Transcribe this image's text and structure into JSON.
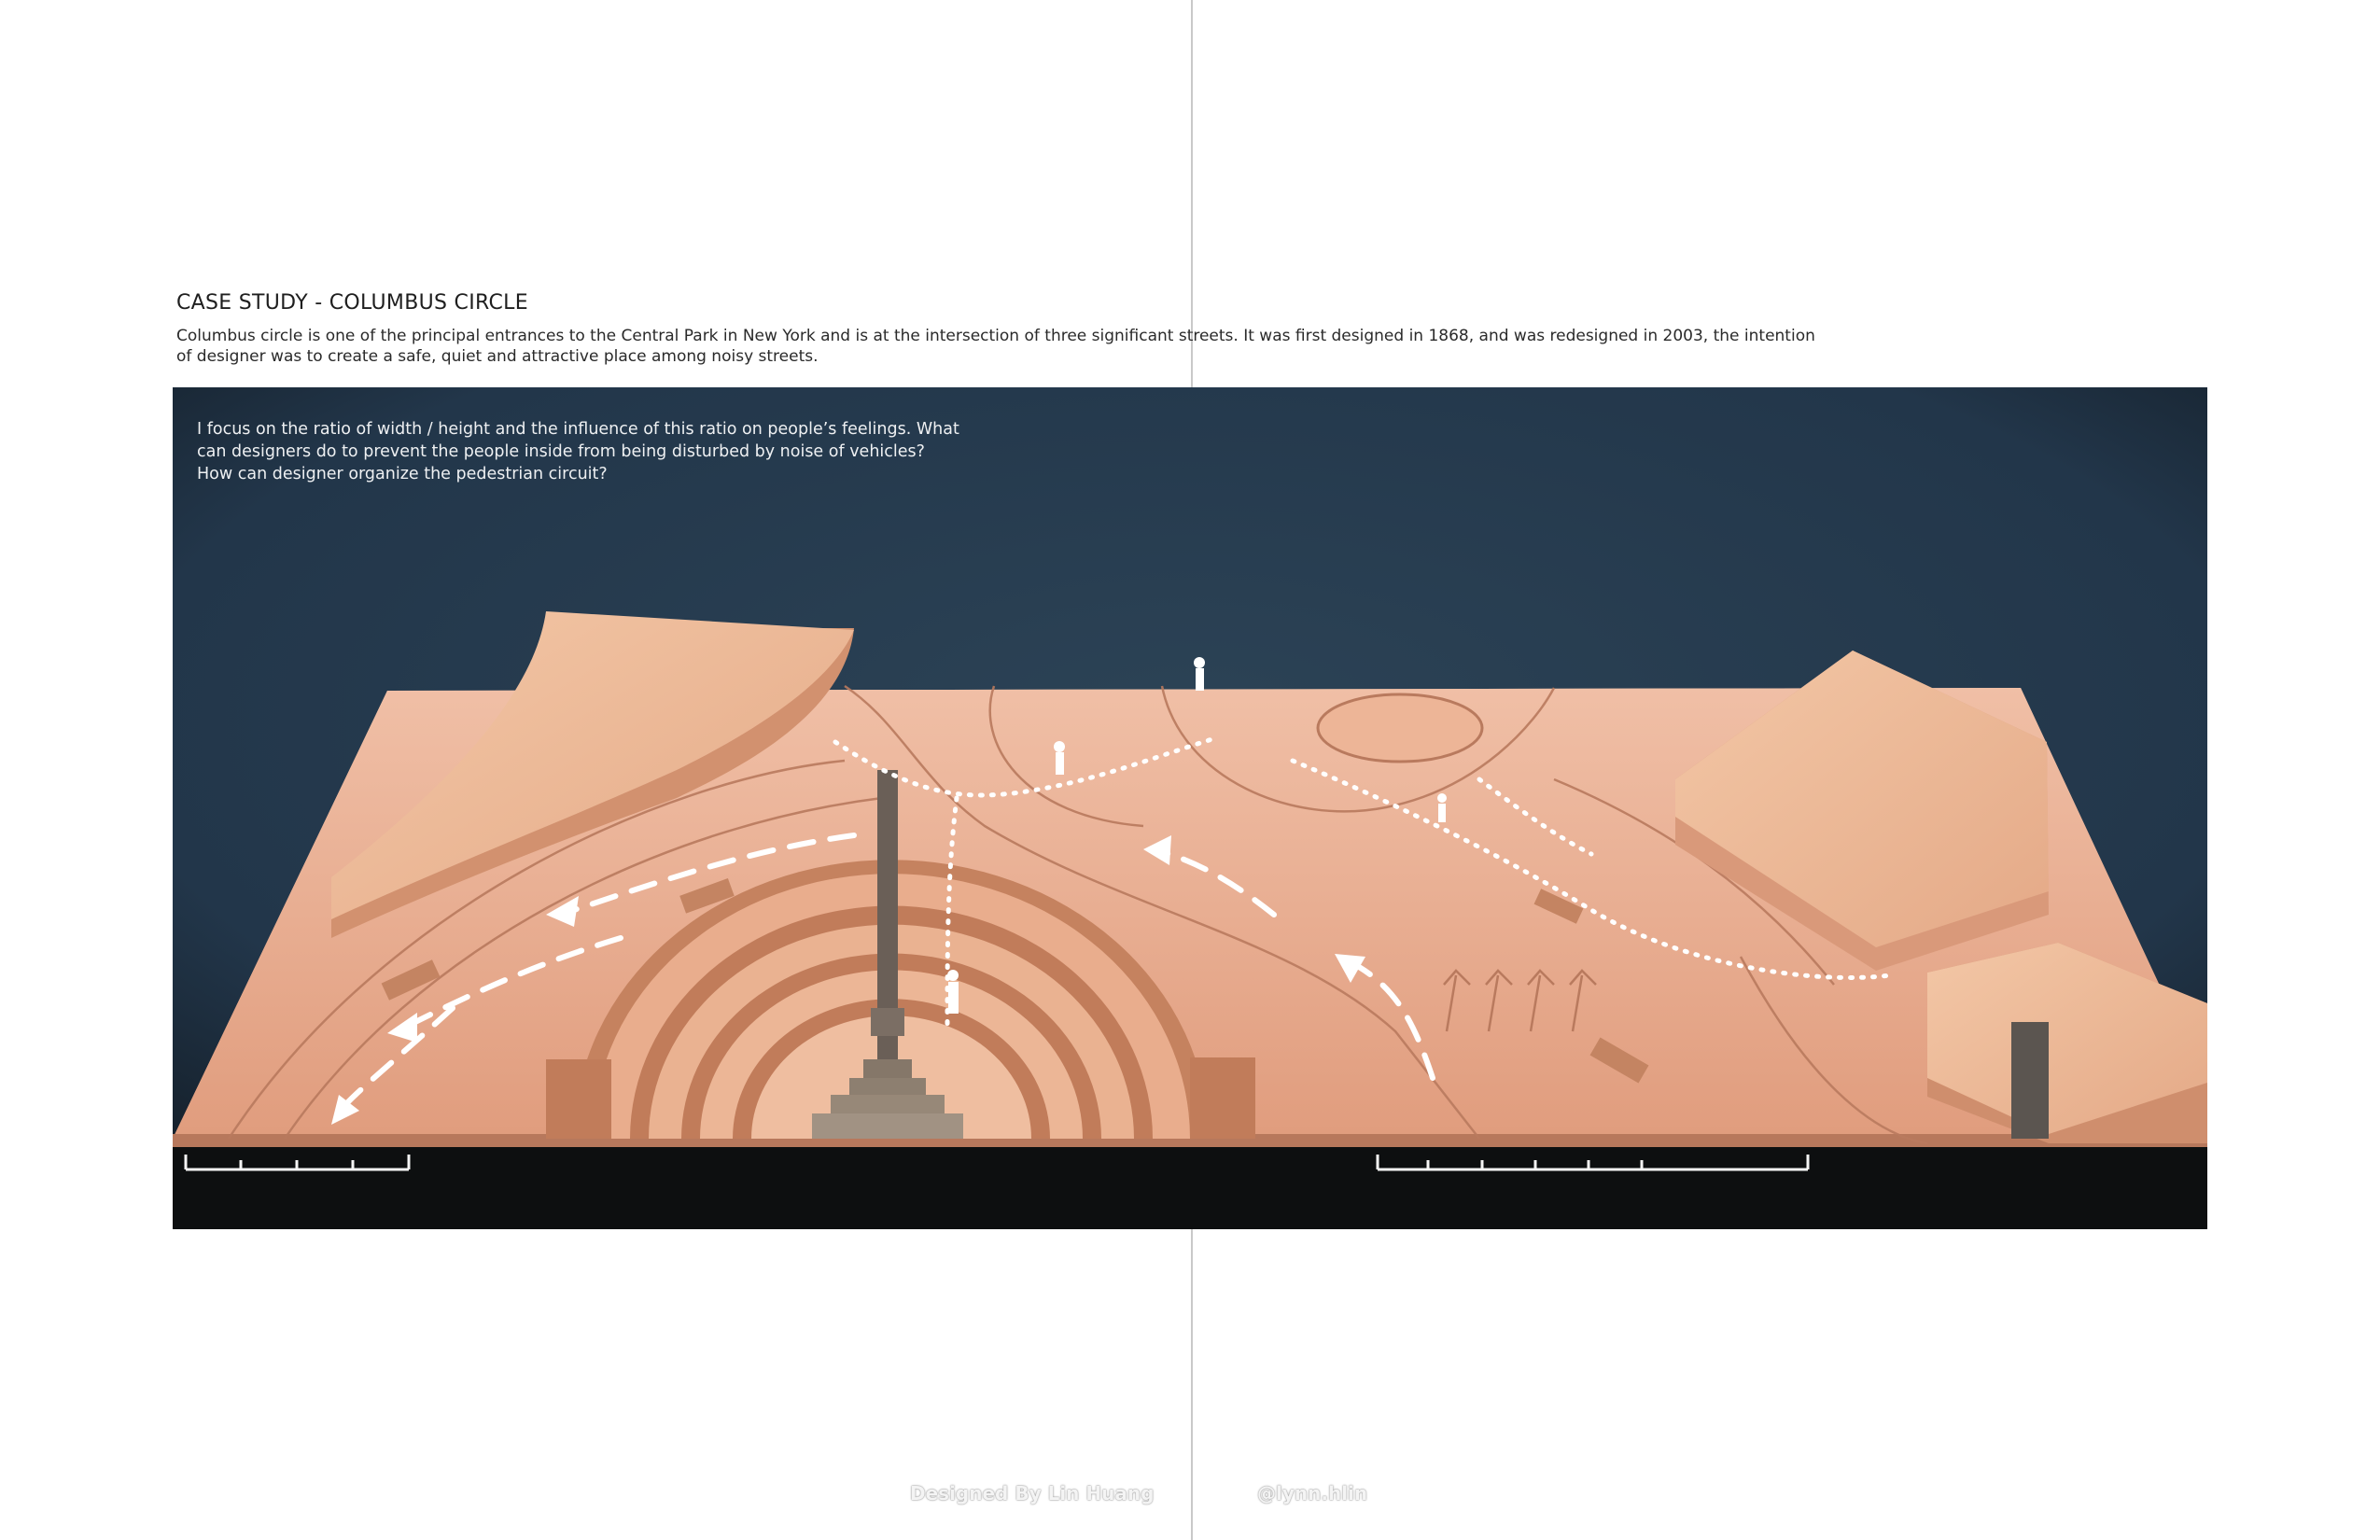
{
  "title": "CASE STUDY - COLUMBUS CIRCLE",
  "intro": "Columbus circle is one of the principal entrances to the Central Park in New York and is at the intersection of three significant streets. It was first designed in 1868, and was redesigned in 2003, the intention of designer was to create a safe, quiet and attractive place among noisy streets.",
  "figure": {
    "note": "I focus on the ratio of width / height and the influence of this ratio on people’s feelings. What can designers do to prevent the people inside from being disturbed by noise of vehicles? How can designer organize the pedestrian circuit?",
    "colors": {
      "backdrop": "#26394a",
      "model": "#e8aa8c",
      "model_shadow": "#c7876a",
      "path": "#ffffff"
    }
  },
  "footer": {
    "credit": "Designed By Lin Huang",
    "handle": "@lynn.hlin"
  }
}
